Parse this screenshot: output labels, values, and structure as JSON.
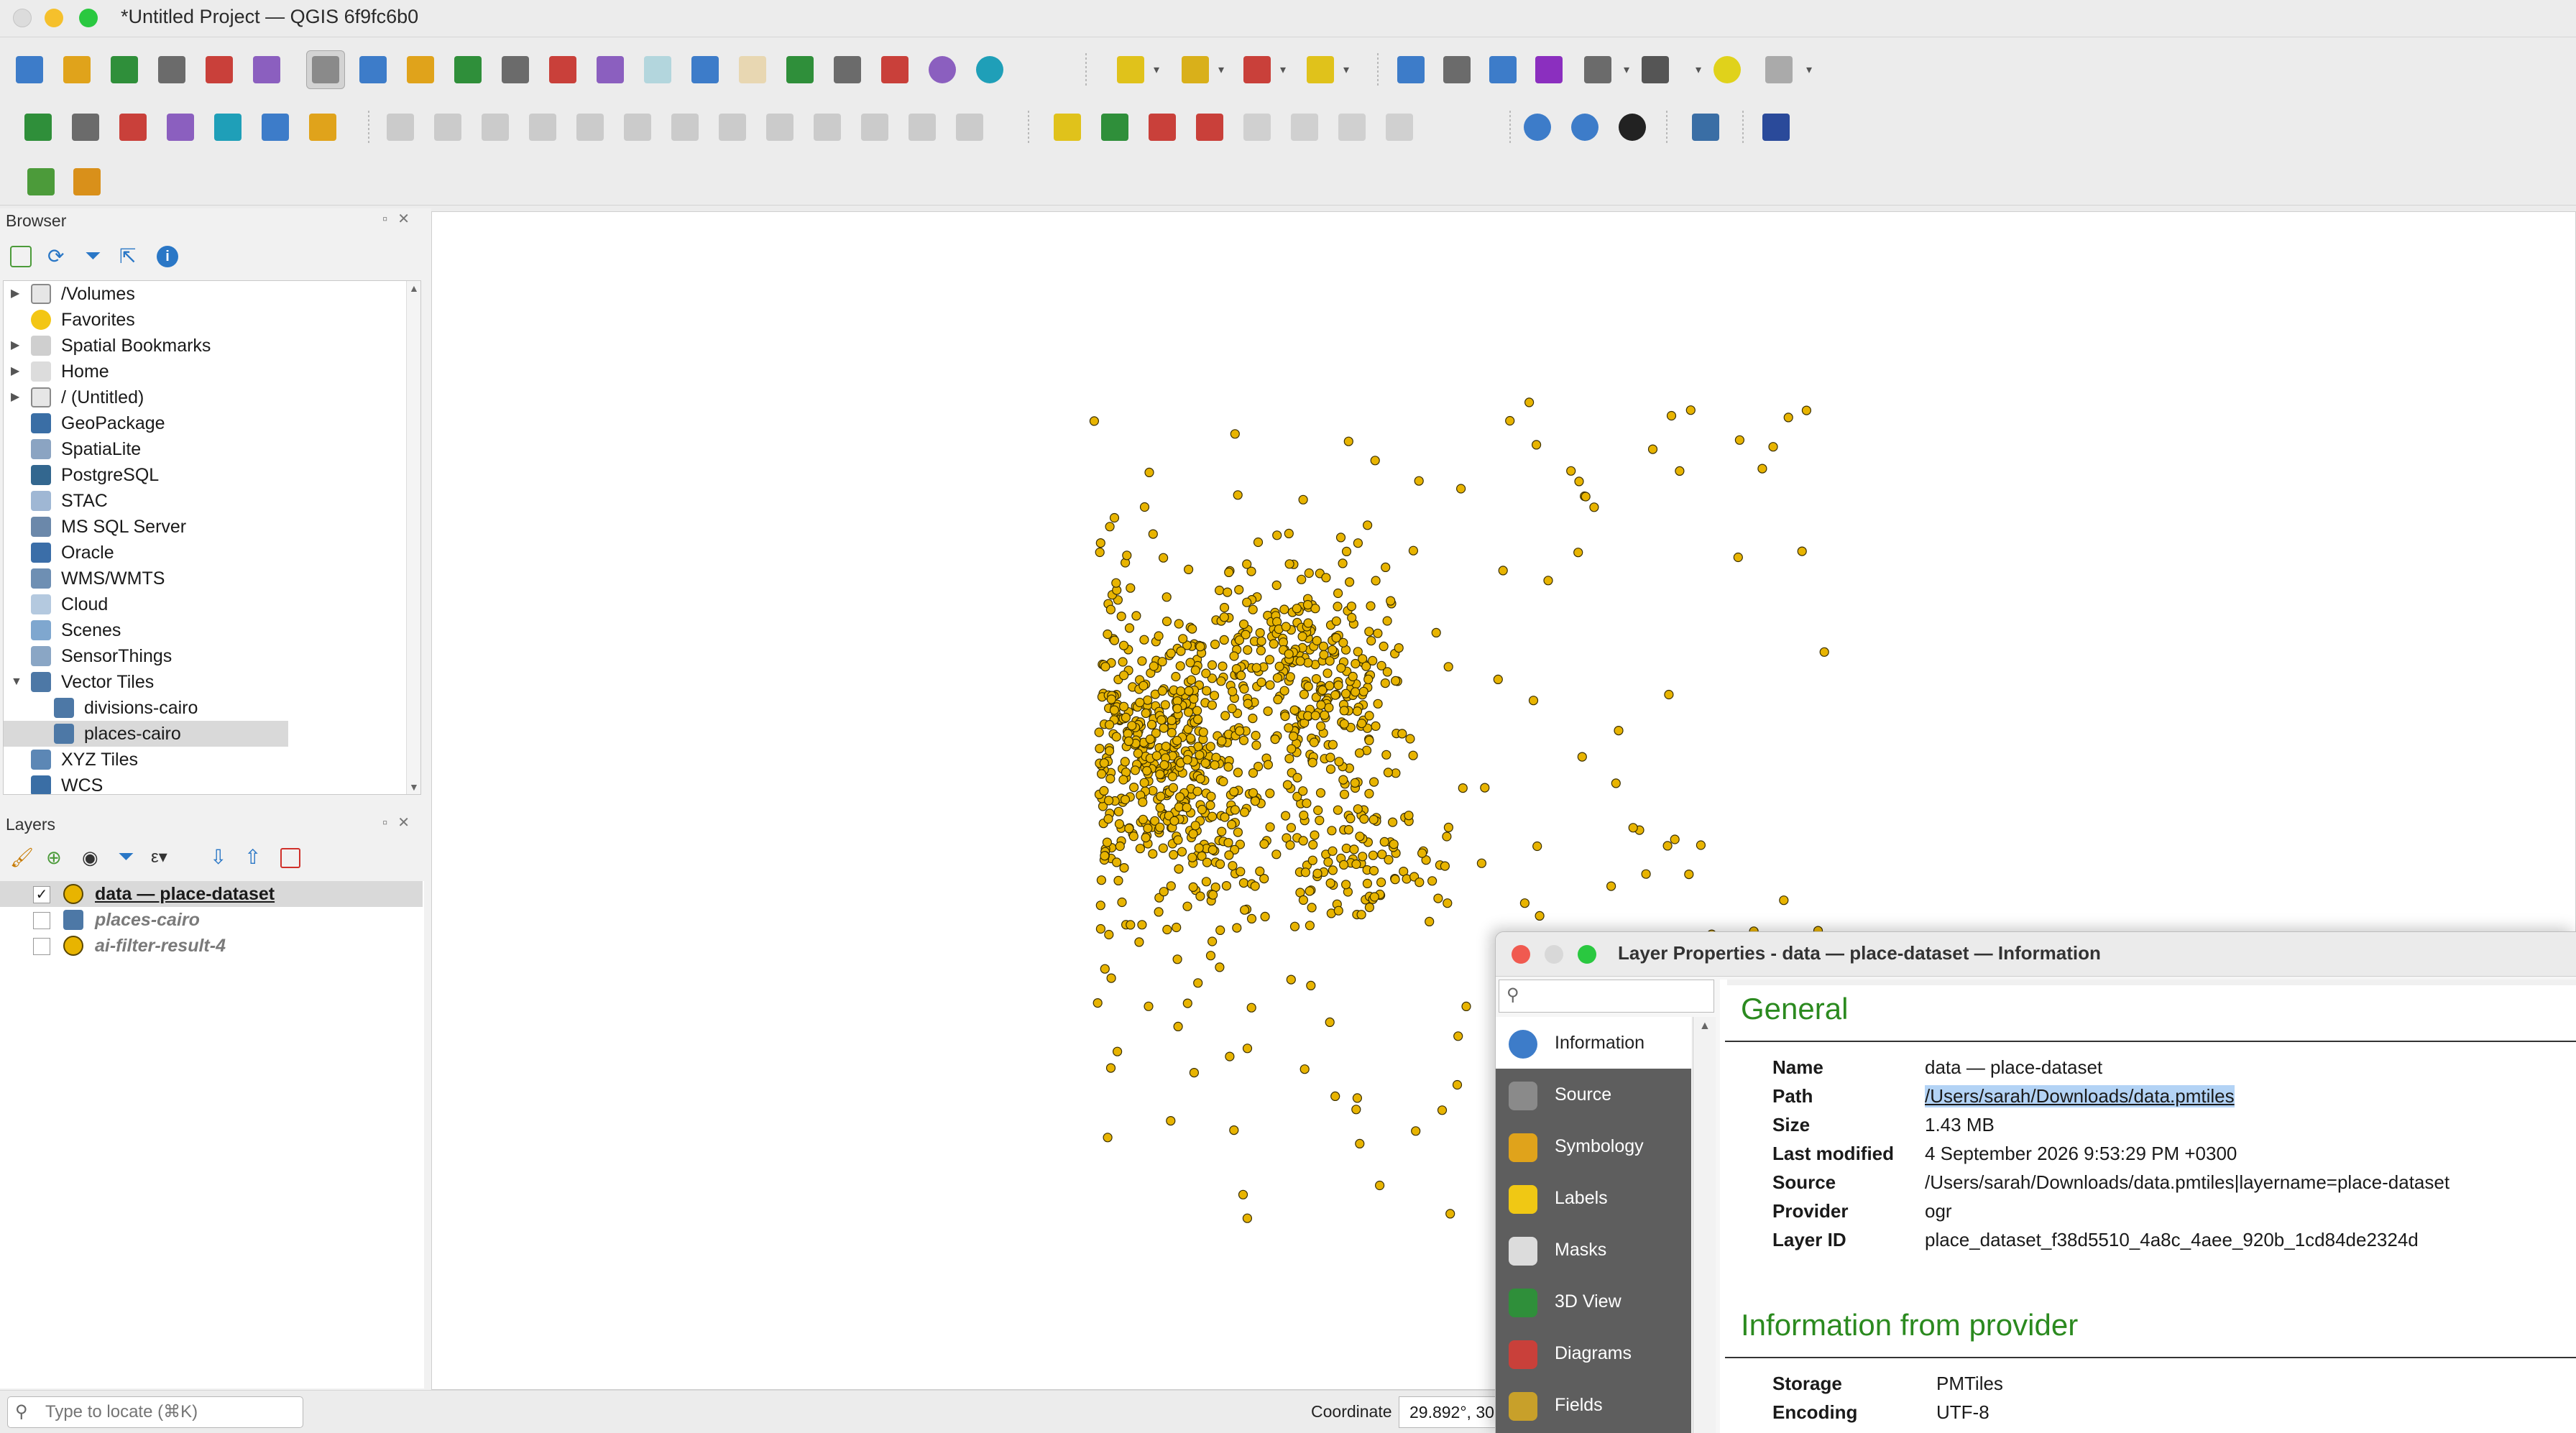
{
  "window": {
    "title": "*Untitled Project — QGIS 6f9fc6b0"
  },
  "browser": {
    "title": "Browser",
    "items": [
      {
        "label": "/Volumes",
        "icon": "folder-icon",
        "expandable": true
      },
      {
        "label": "Favorites",
        "icon": "star-icon",
        "expandable": false
      },
      {
        "label": "Spatial Bookmarks",
        "icon": "bookmark-icon",
        "expandable": true
      },
      {
        "label": "Home",
        "icon": "home-icon",
        "expandable": true
      },
      {
        "label": "/ (Untitled)",
        "icon": "folder-icon",
        "expandable": true
      },
      {
        "label": "GeoPackage",
        "icon": "geopackage-icon",
        "expandable": false
      },
      {
        "label": "SpatiaLite",
        "icon": "spatialite-icon",
        "expandable": false
      },
      {
        "label": "PostgreSQL",
        "icon": "postgresql-icon",
        "expandable": false
      },
      {
        "label": "STAC",
        "icon": "stac-icon",
        "expandable": false
      },
      {
        "label": "MS SQL Server",
        "icon": "mssql-icon",
        "expandable": false
      },
      {
        "label": "Oracle",
        "icon": "oracle-icon",
        "expandable": false
      },
      {
        "label": "WMS/WMTS",
        "icon": "wms-icon",
        "expandable": false
      },
      {
        "label": "Cloud",
        "icon": "cloud-icon",
        "expandable": false
      },
      {
        "label": "Scenes",
        "icon": "scenes-icon",
        "expandable": false
      },
      {
        "label": "SensorThings",
        "icon": "sensorthings-icon",
        "expandable": false
      },
      {
        "label": "Vector Tiles",
        "icon": "vector-tiles-icon",
        "expandable": true
      },
      {
        "label": "divisions-cairo",
        "icon": "vector-tiles-icon",
        "expandable": false
      },
      {
        "label": "places-cairo",
        "icon": "vector-tiles-icon",
        "expandable": false
      },
      {
        "label": "XYZ Tiles",
        "icon": "xyz-tiles-icon",
        "expandable": false
      },
      {
        "label": "WCS",
        "icon": "wcs-icon",
        "expandable": false
      }
    ]
  },
  "layers": {
    "title": "Layers",
    "items": [
      {
        "label": "data — place-dataset",
        "checked": true,
        "icon": "point-layer-icon"
      },
      {
        "label": "places-cairo",
        "checked": false,
        "icon": "vector-tiles-icon"
      },
      {
        "label": "ai-filter-result-4",
        "checked": false,
        "icon": "point-layer-icon"
      }
    ]
  },
  "status": {
    "locator_placeholder": "Type to locate (⌘K)",
    "coordinate_label": "Coordinate",
    "coordinate_value": "29.892°, 30"
  },
  "dialog": {
    "title": "Layer Properties - data — place-dataset — Information",
    "nav": [
      {
        "label": "Information",
        "icon": "information-icon",
        "active": true
      },
      {
        "label": "Source",
        "icon": "source-icon",
        "active": false
      },
      {
        "label": "Symbology",
        "icon": "symbology-icon",
        "active": false
      },
      {
        "label": "Labels",
        "icon": "labels-icon",
        "active": false
      },
      {
        "label": "Masks",
        "icon": "masks-icon",
        "active": false
      },
      {
        "label": "3D View",
        "icon": "3d-view-icon",
        "active": false
      },
      {
        "label": "Diagrams",
        "icon": "diagrams-icon",
        "active": false
      },
      {
        "label": "Fields",
        "icon": "fields-icon",
        "active": false
      }
    ],
    "general_heading": "General",
    "general": [
      {
        "key": "Name",
        "value": "data — place-dataset"
      },
      {
        "key": "Path",
        "value": "/Users/sarah/Downloads/data.pmtiles"
      },
      {
        "key": "Size",
        "value": "1.43 MB"
      },
      {
        "key": "Last modified",
        "value": "4 September 2026 9:53:29 PM +0300"
      },
      {
        "key": "Source",
        "value": "/Users/sarah/Downloads/data.pmtiles|layername=place-dataset"
      },
      {
        "key": "Provider",
        "value": "ogr"
      },
      {
        "key": "Layer ID",
        "value": "place_dataset_f38d5510_4a8c_4aee_920b_1cd84de2324d"
      }
    ],
    "provider_heading": "Information from provider",
    "provider": [
      {
        "key": "Storage",
        "value": "PMTiles"
      },
      {
        "key": "Encoding",
        "value": "UTF-8"
      }
    ]
  },
  "colors": {
    "point_fill": "#e8b400",
    "point_stroke": "#3a2f00",
    "heading_green": "#2b8a1f",
    "link_highlight": "#b3d3f5"
  }
}
